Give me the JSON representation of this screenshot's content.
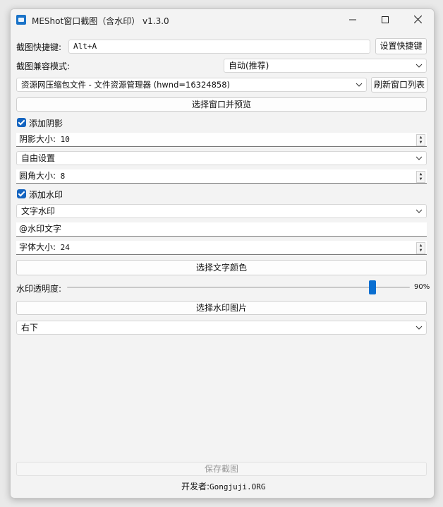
{
  "window": {
    "title": "MEShot窗口截图（含水印） v1.3.0",
    "minimize": "—",
    "maximize": "☐",
    "close": "✕"
  },
  "hotkey": {
    "label": "截图快捷键:",
    "value": "Alt+A",
    "set_button": "设置快捷键"
  },
  "compat": {
    "label": "截图兼容模式:",
    "selected": "自动(推荐)"
  },
  "target_window": {
    "selected": "资源网压缩包文件 - 文件资源管理器 (hwnd=16324858)",
    "refresh_button": "刷新窗口列表",
    "select_preview_button": "选择窗口并预览"
  },
  "shadow": {
    "checkbox_label": "添加阴影",
    "checked": true,
    "size_label": "阴影大小:",
    "size_value": "10",
    "mode_selected": "自由设置"
  },
  "corner": {
    "label": "圆角大小:",
    "value": "8"
  },
  "watermark": {
    "checkbox_label": "添加水印",
    "checked": true,
    "type_selected": "文字水印",
    "text_value": "@水印文字",
    "font_size_label": "字体大小:",
    "font_size_value": "24",
    "text_color_button": "选择文字颜色",
    "opacity_label": "水印透明度:",
    "opacity_percent": 90,
    "opacity_text": "90%",
    "image_button": "选择水印图片",
    "position_selected": "右下"
  },
  "footer": {
    "save_button": "保存截图",
    "developer_label": "开发者:",
    "developer_site": "Gongjuji.ORG"
  },
  "colors": {
    "accent": "#0a6fd1",
    "check": "#1464c0",
    "window_bg": "#f3f3f3"
  }
}
